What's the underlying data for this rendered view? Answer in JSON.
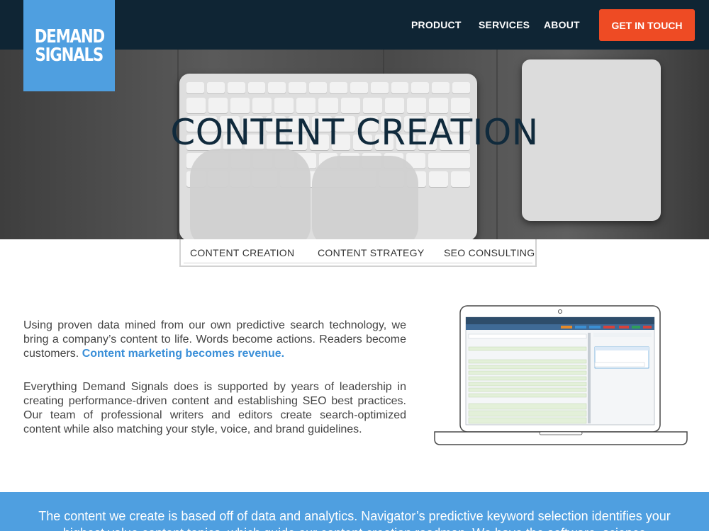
{
  "logo": {
    "line1": "DEMAND",
    "line2": "SIGNALS"
  },
  "nav": {
    "items": [
      {
        "label": "PRODUCT"
      },
      {
        "label": "SERVICES"
      },
      {
        "label": "ABOUT"
      }
    ],
    "cta_label": "GET IN TOUCH"
  },
  "hero": {
    "title": "CONTENT CREATION"
  },
  "subnav": {
    "tabs": [
      {
        "label": "CONTENT CREATION"
      },
      {
        "label": "CONTENT STRATEGY"
      },
      {
        "label": "SEO CONSULTING"
      }
    ]
  },
  "content": {
    "p1_text": "Using proven data mined from our own predictive search technology, we bring a company’s content to life. Words become actions. Readers become customers.",
    "p1_highlight": "Content marketing becomes revenue.",
    "p2_text": "Everything Demand Signals does is supported by years of leadership in creating performance-driven content and establishing SEO best practices. Our team of professional writers and editors create search-optimized content while also matching your style, voice, and brand guidelines."
  },
  "band": {
    "text": "The content we create is based off of data and analytics. Navigator’s predictive keyword selection identifies your highest value content topics, which guide our content creation roadmap. We have the software, science"
  },
  "colors": {
    "nav_bg": "#0f2534",
    "brand_blue": "#4f9fe0",
    "cta_orange": "#ee4b24",
    "title_navy": "#102a3c",
    "link_blue": "#3a8fd8"
  }
}
